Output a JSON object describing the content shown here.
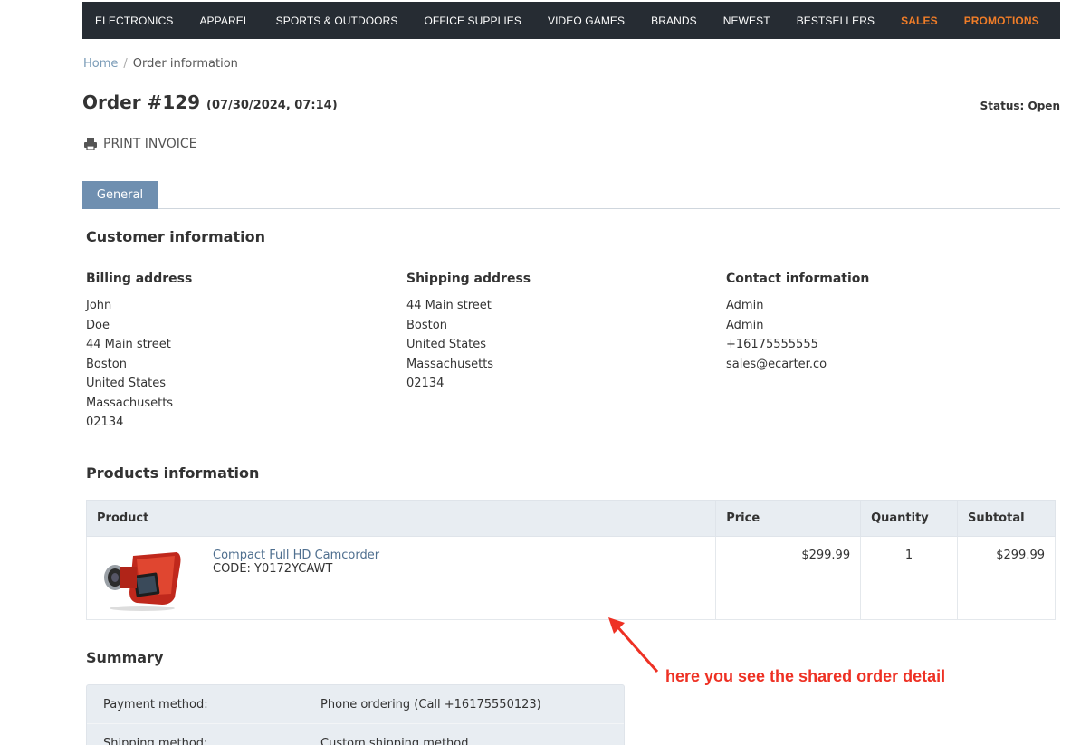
{
  "nav": {
    "items": [
      {
        "label": "ELECTRONICS"
      },
      {
        "label": "APPAREL"
      },
      {
        "label": "SPORTS & OUTDOORS"
      },
      {
        "label": "OFFICE SUPPLIES"
      },
      {
        "label": "VIDEO GAMES"
      },
      {
        "label": "BRANDS"
      },
      {
        "label": "NEWEST"
      },
      {
        "label": "BESTSELLERS"
      },
      {
        "label": "SALES"
      },
      {
        "label": "PROMOTIONS"
      }
    ],
    "highlight_color": "#f07d28"
  },
  "breadcrumb": {
    "home": "Home",
    "sep": "/",
    "current": "Order information"
  },
  "order": {
    "title": "Order #129",
    "date": "(07/30/2024, 07:14)",
    "status": "Status: Open"
  },
  "print_label": "PRINT INVOICE",
  "tabs": [
    {
      "label": "General"
    }
  ],
  "customer": {
    "heading": "Customer information",
    "billing": {
      "heading": "Billing address",
      "lines": [
        "John",
        "Doe",
        "44 Main street",
        "Boston",
        "United States",
        "Massachusetts",
        "02134"
      ]
    },
    "shipping": {
      "heading": "Shipping address",
      "lines": [
        "44 Main street",
        "Boston",
        "United States",
        "Massachusetts",
        "02134"
      ]
    },
    "contact": {
      "heading": "Contact information",
      "lines": [
        "Admin",
        "Admin",
        "+16175555555",
        "sales@ecarter.co"
      ]
    }
  },
  "products": {
    "heading": "Products information",
    "columns": {
      "product": "Product",
      "price": "Price",
      "quantity": "Quantity",
      "subtotal": "Subtotal"
    },
    "rows": [
      {
        "name": "Compact Full HD Camcorder",
        "code": "CODE: Y0172YCAWT",
        "price": "$299.99",
        "quantity": "1",
        "subtotal": "$299.99",
        "image_icon": "camcorder-icon"
      }
    ]
  },
  "summary": {
    "heading": "Summary",
    "rows": [
      {
        "key": "Payment method:",
        "value": "Phone ordering (Call +16175550123)"
      },
      {
        "key": "Shipping method:",
        "value": "Custom shipping method"
      }
    ]
  },
  "annotation": {
    "text": "here you see the shared order detail",
    "color": "#ee3124"
  }
}
